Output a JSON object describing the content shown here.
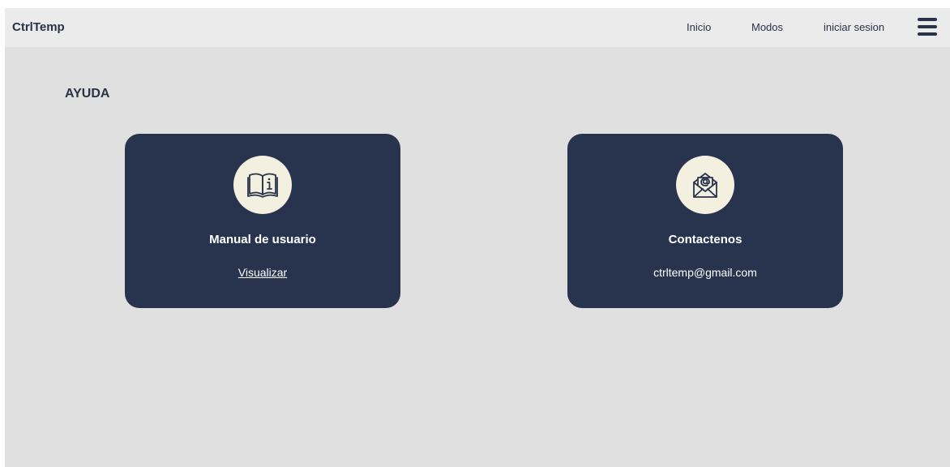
{
  "navbar": {
    "brand": "CtrlTemp",
    "links": [
      "Inicio",
      "Modos",
      "iniciar sesion"
    ],
    "menu_icon": "hamburger-menu-icon"
  },
  "page": {
    "title": "AYUDA"
  },
  "cards": {
    "manual": {
      "icon": "book-info-icon",
      "title": "Manual de usuario",
      "link_label": "Visualizar"
    },
    "contact": {
      "icon": "envelope-at-icon",
      "title": "Contactenos",
      "email": "ctrltemp@gmail.com"
    }
  },
  "colors": {
    "background": "#e0e0e0",
    "navbar": "#ebebeb",
    "card": "#28344e",
    "icon_circle": "#f4f0e0",
    "text_dark": "#283349"
  }
}
